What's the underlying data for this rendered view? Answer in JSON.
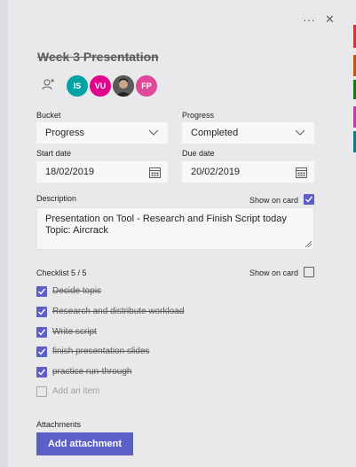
{
  "header": {
    "more_label": "···",
    "close_label": "✕"
  },
  "task": {
    "title": "Week 3 Presentation"
  },
  "assignees": [
    {
      "initials": "IS",
      "color": "#00a3a3"
    },
    {
      "initials": "VU",
      "color": "#e3008c"
    },
    {
      "initials": "",
      "color": "#3b3b3b"
    },
    {
      "initials": "FP",
      "color": "#e0489b"
    }
  ],
  "fields": {
    "bucket_label": "Bucket",
    "bucket_value": "Progress",
    "progress_label": "Progress",
    "progress_value": "Completed",
    "start_label": "Start date",
    "start_value": "18/02/2019",
    "due_label": "Due date",
    "due_value": "20/02/2019"
  },
  "description": {
    "label": "Description",
    "show_on_card_label": "Show on card",
    "show_on_card_checked": true,
    "line1": "Presentation on Tool - Research and Finish Script today",
    "line2": "Topic: Aircrack"
  },
  "checklist": {
    "label": "Checklist 5 / 5",
    "show_on_card_label": "Show on card",
    "show_on_card_checked": false,
    "items": [
      {
        "text": "Decide topic",
        "checked": true
      },
      {
        "text": "Research and distribute workload",
        "checked": true
      },
      {
        "text": "Write script",
        "checked": true
      },
      {
        "text": "finish presentation slides",
        "checked": true
      },
      {
        "text": "practice run-through",
        "checked": true
      }
    ],
    "add_item_placeholder": "Add an item"
  },
  "attachments": {
    "label": "Attachments",
    "button_label": "Add attachment"
  },
  "colors": {
    "accent": "#5b5fc7"
  }
}
